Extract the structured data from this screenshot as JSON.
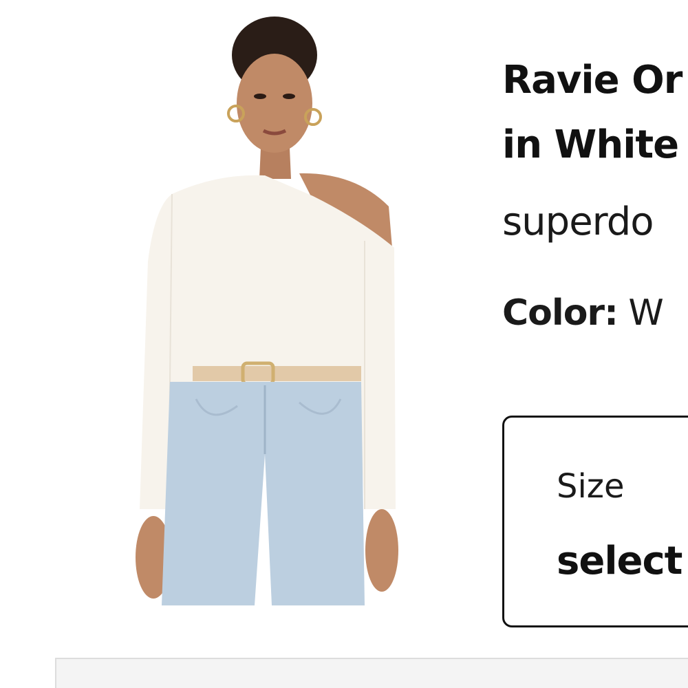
{
  "product": {
    "title_line1": "Ravie Or",
    "title_line2": "in White",
    "brand": "superdo",
    "color_label": "Color:",
    "color_value": "W"
  },
  "size": {
    "label": "Size",
    "value": "select"
  },
  "colors": {
    "text": "#111111",
    "border": "#111111",
    "background": "#ffffff"
  }
}
